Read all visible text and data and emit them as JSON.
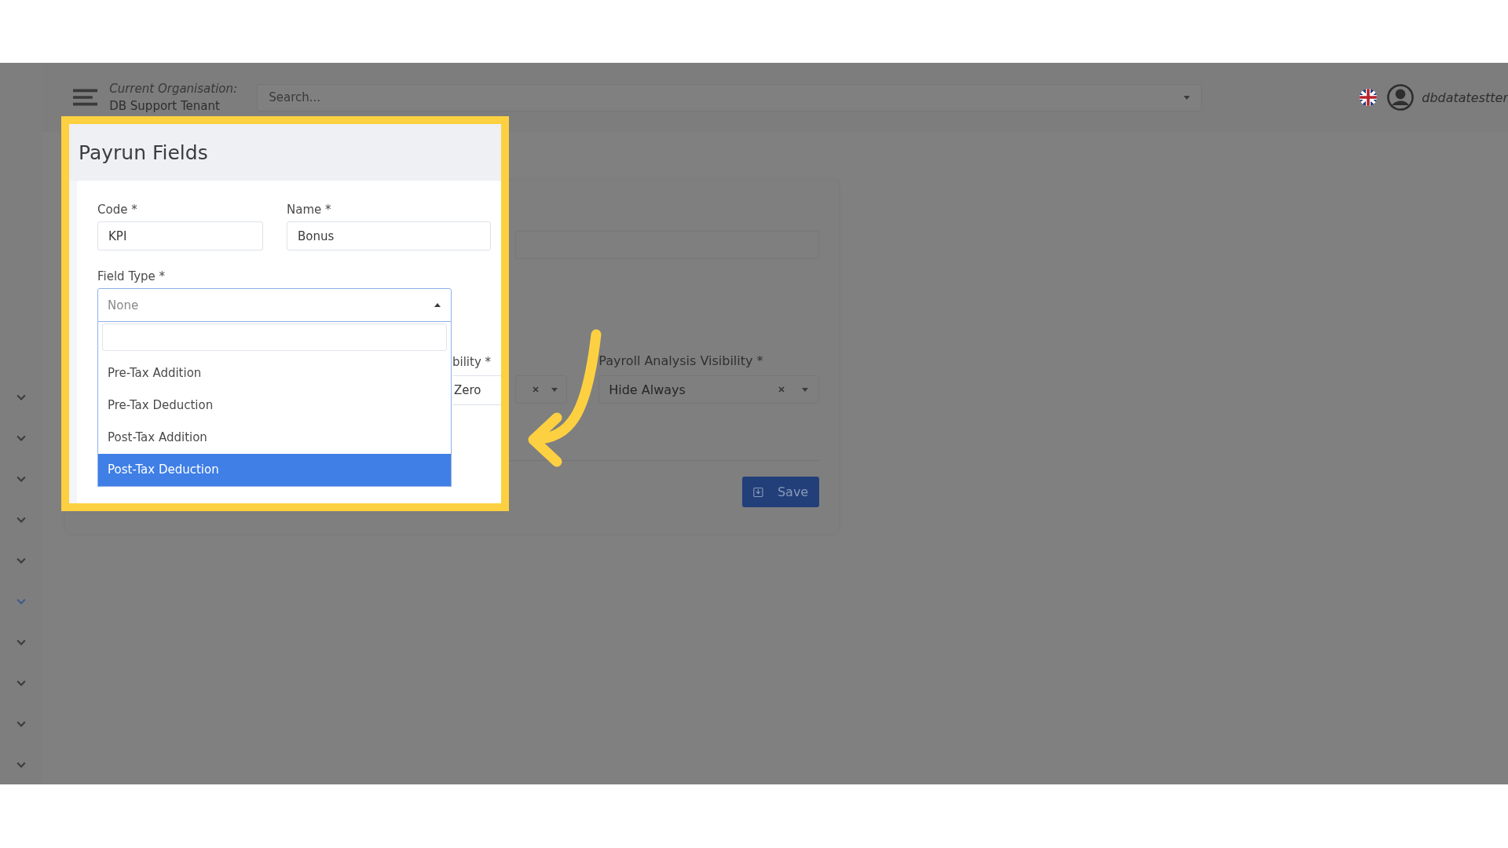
{
  "header": {
    "org_label": "Current Organisation:",
    "org_name": "DB Support Tenant",
    "search": {
      "placeholder": "Search..."
    },
    "username": "dbdatatestter"
  },
  "sidebar": {
    "chevrons": [
      {
        "selected": false
      },
      {
        "selected": false
      },
      {
        "selected": false
      },
      {
        "selected": false
      },
      {
        "selected": false
      },
      {
        "selected": true
      },
      {
        "selected": false
      },
      {
        "selected": false
      },
      {
        "selected": false
      },
      {
        "selected": false
      }
    ]
  },
  "form": {
    "payroll_analysis": {
      "label": "Payroll Analysis Visibility *",
      "value": "Hide Always"
    },
    "save_button": "Save"
  },
  "inset": {
    "title": "Payrun Fields",
    "code": {
      "label": "Code *",
      "value": "KPI"
    },
    "name": {
      "label": "Name *",
      "value": "Bonus"
    },
    "field_type": {
      "label": "Field Type *",
      "value": "None",
      "expanded": true,
      "options": [
        {
          "label": "Pre-Tax Addition",
          "selected": false
        },
        {
          "label": "Pre-Tax Deduction",
          "selected": false
        },
        {
          "label": "Post-Tax Addition",
          "selected": false
        },
        {
          "label": "Post-Tax Deduction",
          "selected": true
        }
      ]
    },
    "cut_label": "bility *",
    "cut_value": "Zero"
  }
}
